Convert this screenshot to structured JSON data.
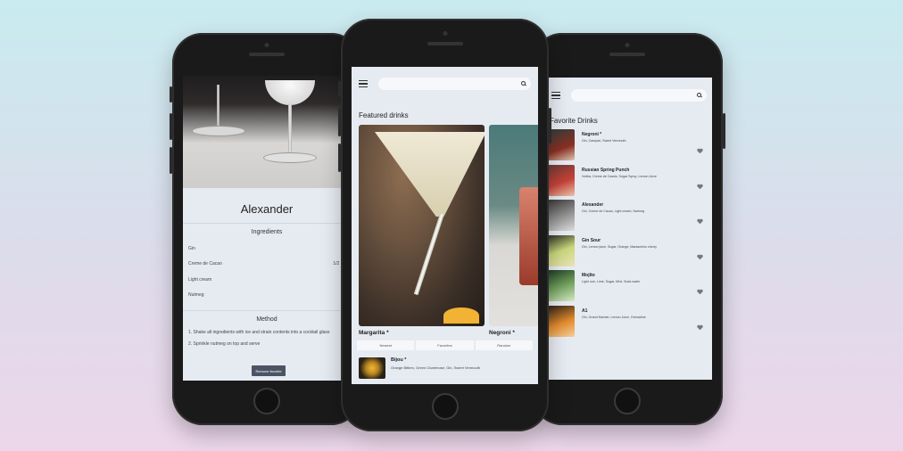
{
  "left_phone": {
    "drink_name": "Alexander",
    "ingredients_heading": "Ingredients",
    "ingredients": [
      {
        "name": "Gin",
        "amount": ""
      },
      {
        "name": "Creme de Cacao",
        "amount": "1/2 oz"
      },
      {
        "name": "Light cream",
        "amount": ""
      },
      {
        "name": "Nutmeg",
        "amount": ""
      }
    ],
    "method_heading": "Method",
    "method_steps": [
      "1. Shake all ingredients with ice and strain contents into a cocktail glass",
      "2. Sprinkle nutmeg on top and serve"
    ],
    "remove_button": "Remove favorite"
  },
  "center_phone": {
    "featured_title": "Featured drinks",
    "featured": [
      {
        "name": "Margarita *"
      },
      {
        "name": "Negroni *"
      }
    ],
    "tabs": [
      "Newest",
      "Favorites",
      "Random"
    ],
    "list": [
      {
        "name": "Bijou *",
        "desc": "Orange Bitters, Green Chartreuse, Gin, Sweet Vermouth"
      }
    ]
  },
  "right_phone": {
    "title": "Favorite Drinks",
    "items": [
      {
        "name": "Negroni *",
        "desc": "Gin, Campari, Sweet Vermouth",
        "color": "#8b2f22"
      },
      {
        "name": "Russian Spring Punch",
        "desc": "Vodka, Creme de Cassis, Sugar Syrup, Lemon Juice",
        "color": "#c6413a"
      },
      {
        "name": "Alexander",
        "desc": "Gin, Creme de Cacao, Light cream, Nutmeg",
        "color": "#8c8c8c"
      },
      {
        "name": "Gin Sour",
        "desc": "Gin, Lemon juice, Sugar, Orange, Maraschino cherry",
        "color": "#c9d77a"
      },
      {
        "name": "Mojito",
        "desc": "Light rum, Lime, Sugar, Mint, Soda water",
        "color": "#6f9e5b"
      },
      {
        "name": "A1",
        "desc": "Gin, Grand Marnier, Lemon Juice, Grenadine",
        "color": "#e38a2c"
      }
    ]
  }
}
